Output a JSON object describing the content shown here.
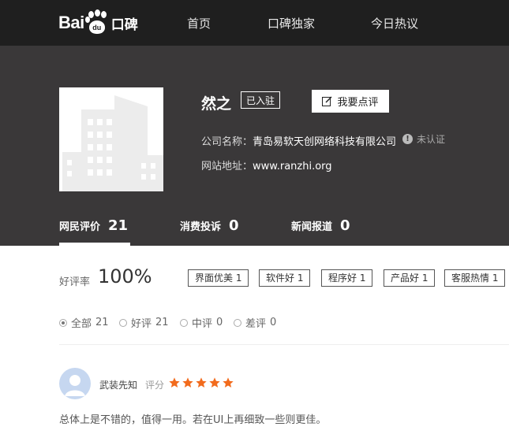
{
  "header": {
    "logo_bai": "Bai",
    "logo_du": "du",
    "logo_koubei": "口碑",
    "nav": [
      "首页",
      "口碑独家",
      "今日热议"
    ]
  },
  "company": {
    "name": "然之",
    "joined_badge": "已入驻",
    "review_button": "我要点评",
    "company_label": "公司名称：",
    "company_value": "青岛易软天创网络科技有限公司",
    "verify_status": "未认证",
    "site_label": "网站地址：",
    "site_value": "www.ranzhi.org"
  },
  "tabs": [
    {
      "label": "网民评价",
      "count": "21"
    },
    {
      "label": "消费投诉",
      "count": "0"
    },
    {
      "label": "新闻报道",
      "count": "0"
    }
  ],
  "rating": {
    "label": "好评率",
    "value": "100%"
  },
  "tags": [
    "界面优美 1",
    "软件好 1",
    "程序好 1",
    "产品好 1",
    "客服热情 1"
  ],
  "filters": [
    {
      "label": "全部",
      "count": "21",
      "selected": true
    },
    {
      "label": "好评",
      "count": "21",
      "selected": false
    },
    {
      "label": "中评",
      "count": "0",
      "selected": false
    },
    {
      "label": "差评",
      "count": "0",
      "selected": false
    }
  ],
  "review": {
    "user": "武装先知",
    "score_label": "评分",
    "stars": 5,
    "text": "总体上是不错的，值得一用。若在UI上再细致一些则更佳。"
  },
  "colors": {
    "topbar": "#1f1f1f",
    "banner": "#3a3839",
    "star": "#f26b1d",
    "avatar": "#c6d7f0"
  }
}
